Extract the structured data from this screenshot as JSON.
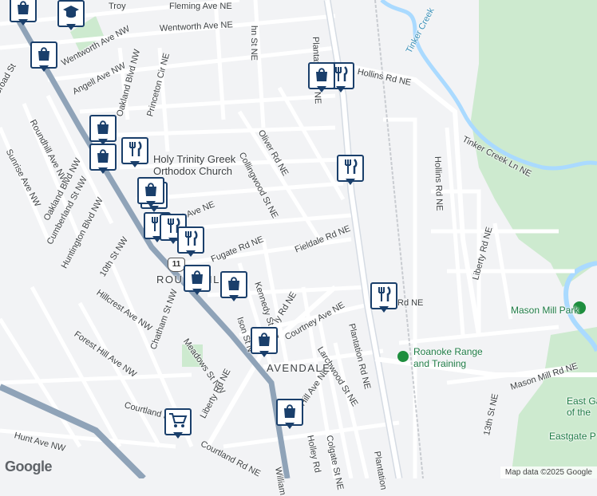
{
  "map": {
    "street_labels": [
      "Fleming Ave NE",
      "Troy",
      "Wentworth Ave NE",
      "Wentworth Ave NW",
      "Angell Ave NW",
      "Oakland Blvd NW",
      "Princeton Cir NE",
      "Roundhill Ave NW",
      "Sunrise Ave NW",
      "Oakland Blvd NW",
      "Cumberland St NW",
      "Huntington Blvd NW",
      "10th St NW",
      "Hillcrest Ave NW",
      "Forest Hill Ave NW",
      "Chatham St NW",
      "Meadows St NW",
      "Liberty Rd NE",
      "Courtland Rd",
      "Courtland Rd NE",
      "Hunt Ave NW",
      "Oliver Rd NE",
      "Collingwood St NE",
      "Fieldale Rd NE",
      "Kennedy St NE",
      "Fugate Rd NE",
      "Courtney Ave NE",
      "Larchwood St NE",
      "Hill Ave NE",
      "Holley Rd",
      "Colgate St NE",
      "Plantation Rd NE",
      "Plantation Rd NE",
      "Plantation",
      "Hollins Rd NE",
      "Hollins Rd NE",
      "Tinker Creek Ln NE",
      "Liberty Rd NE",
      "Mason Mill Rd NE",
      "13th St NE",
      "Rd NE",
      "William",
      "Broad St",
      "hn St NE",
      "st Ave NE",
      "Ison St N",
      "ly Rd NE"
    ],
    "area_labels": [
      "ROUNDHILL",
      "AVENDALE"
    ],
    "water_labels": [
      "Tinker Creek"
    ],
    "route_shield": "11",
    "poi": [
      {
        "name": "Holy Trinity Greek Orthodox Church",
        "lines": [
          "Holy Trinity Greek",
          "Orthodox Church"
        ],
        "icon": "church-icon"
      },
      {
        "name": "Mason Mill Park",
        "icon": "park-icon"
      },
      {
        "name": "Roanoke Range and Training",
        "lines": [
          "Roanoke Range",
          "and Training"
        ],
        "icon": "range-icon"
      },
      {
        "name": "East Gate of the",
        "lines": [
          "East Ga",
          "of the"
        ],
        "icon": ""
      },
      {
        "name": "Eastgate P",
        "icon": ""
      }
    ],
    "markers": [
      {
        "type": "school",
        "icon": "school-icon"
      },
      {
        "type": "shopping",
        "icon": "shopping-bag-icon"
      },
      {
        "type": "shopping",
        "icon": "shopping-bag-icon"
      },
      {
        "type": "restaurant",
        "icon": "fork-knife-icon"
      },
      {
        "type": "shopping",
        "icon": "shopping-bag-icon"
      },
      {
        "type": "restaurant",
        "icon": "fork-knife-icon"
      },
      {
        "type": "shopping",
        "icon": "shopping-bag-icon"
      },
      {
        "type": "restaurant",
        "icon": "fork-knife-icon"
      },
      {
        "type": "shopping",
        "icon": "shopping-bag-icon"
      },
      {
        "type": "restaurant",
        "icon": "fork-knife-icon"
      },
      {
        "type": "restaurant",
        "icon": "fork-knife-icon"
      },
      {
        "type": "restaurant",
        "icon": "fork-knife-icon"
      },
      {
        "type": "shopping",
        "icon": "shopping-bag-icon"
      },
      {
        "type": "shopping",
        "icon": "shopping-bag-icon"
      },
      {
        "type": "shopping",
        "icon": "shopping-bag-icon"
      },
      {
        "type": "shopping",
        "icon": "shopping-bag-icon"
      },
      {
        "type": "shopping",
        "icon": "shopping-bag-icon"
      },
      {
        "type": "grocery",
        "icon": "shopping-cart-icon"
      },
      {
        "type": "shopping",
        "icon": "shopping-bag-icon"
      },
      {
        "type": "restaurant",
        "icon": "fork-knife-icon"
      }
    ],
    "colors": {
      "land": "#f2f3f5",
      "road": "#ffffff",
      "highway": "#8fa3b8",
      "park": "#cdeacf",
      "water": "#aadaff",
      "marker_border": "#1a3f6b"
    }
  },
  "footer": {
    "logo": "Google",
    "attribution": "Map data ©2025 Google"
  }
}
